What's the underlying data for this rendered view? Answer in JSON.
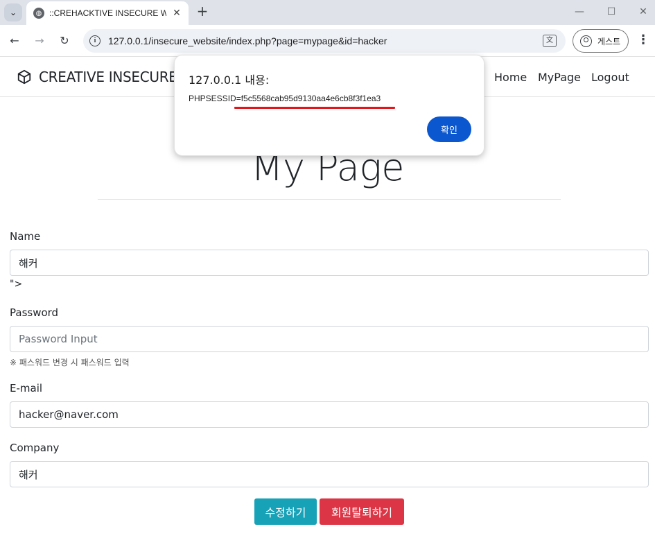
{
  "browser": {
    "tab_title": "::CREHACKTIVE INSECURE WEB",
    "url": "127.0.0.1/insecure_website/index.php?page=mypage&id=hacker",
    "guest_label": "게스트",
    "icons": [
      "tab-list-icon",
      "globe-icon",
      "close-icon",
      "plus-icon",
      "minimize-icon",
      "maximize-icon",
      "window-close-icon",
      "back-arrow-icon",
      "forward-arrow-icon",
      "reload-icon",
      "info-icon",
      "translate-icon",
      "profile-icon",
      "kebab-menu-icon"
    ]
  },
  "site": {
    "brand": "CREATIVE INSECURE W",
    "nav": {
      "home": "Home",
      "mypage": "MyPage",
      "logout": "Logout"
    }
  },
  "page": {
    "title": "My Page",
    "name_label": "Name",
    "name_value": "해커",
    "stray_text": "\">",
    "password_label": "Password",
    "password_placeholder": "Password Input",
    "password_hint": "※ 패스워드 변경 시 패스워드 입력",
    "email_label": "E-mail",
    "email_value": "hacker@naver.com",
    "company_label": "Company",
    "company_value": "해커",
    "edit_button": "수정하기",
    "withdraw_button": "회원탈퇴하기"
  },
  "dialog": {
    "title": "127.0.0.1 내용:",
    "message": "PHPSESSID=f5c5568cab95d9130aa4e6cb8f3f1ea3",
    "ok_button": "확인"
  },
  "colors": {
    "edit_button": "#17a2b8",
    "withdraw_button": "#dc3545",
    "dialog_ok": "#0b57d0",
    "highlight_underline": "#e5141b"
  }
}
